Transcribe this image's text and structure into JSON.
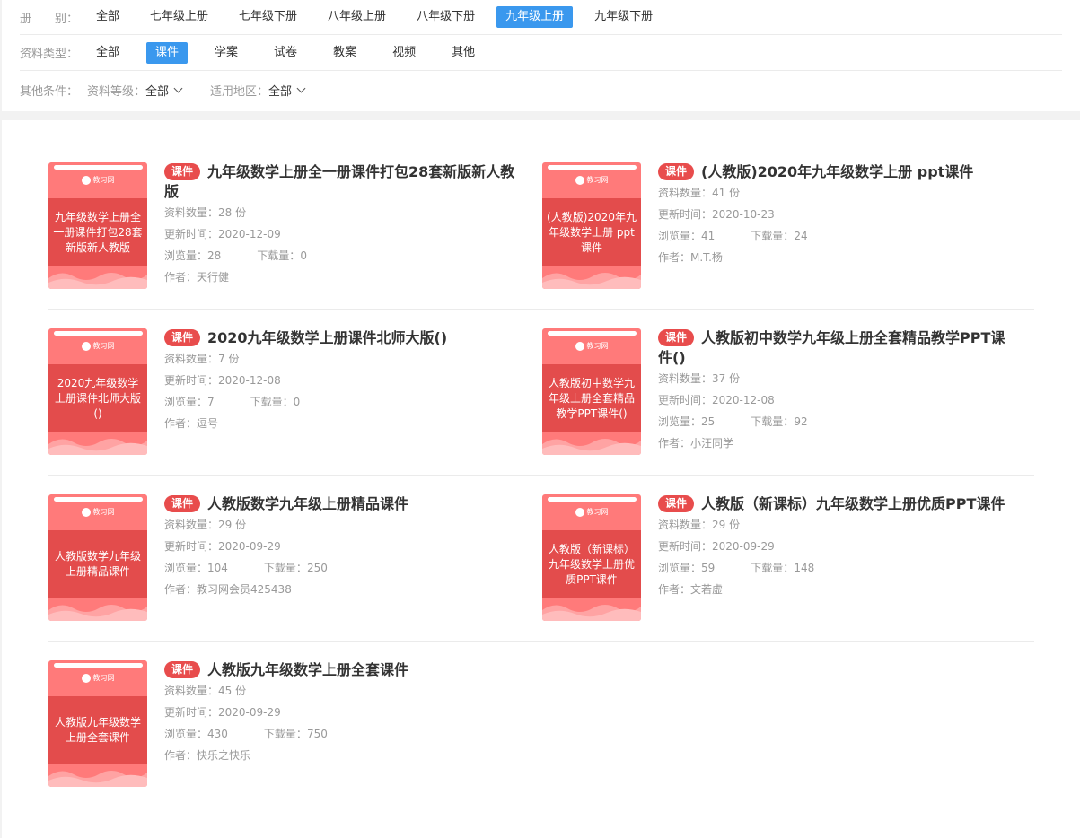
{
  "filters": {
    "grade": {
      "label": "册　　别：",
      "options": [
        "全部",
        "七年级上册",
        "七年级下册",
        "八年级上册",
        "八年级下册",
        "九年级上册",
        "九年级下册"
      ],
      "active": "九年级上册"
    },
    "type": {
      "label": "资料类型：",
      "options": [
        "全部",
        "课件",
        "学案",
        "试卷",
        "教案",
        "视频",
        "其他"
      ],
      "active": "课件"
    },
    "other": {
      "label": "其他条件：",
      "level_label": "资料等级：",
      "level_value": "全部",
      "region_label": "适用地区：",
      "region_value": "全部"
    }
  },
  "cover_logo": "教习网",
  "labels": {
    "tag": "课件",
    "count": "资料数量：",
    "count_unit": " 份",
    "updated": "更新时间：",
    "views": "浏览量：",
    "downloads": "下载量：",
    "author": "作者："
  },
  "items": [
    {
      "title": "九年级数学上册全一册课件打包28套新版新人教版",
      "cover_text": "九年级数学上册全一册课件打包28套新版新人教版",
      "count": "28",
      "updated": "2020-12-09",
      "views": "28",
      "downloads": "0",
      "author": "天行健"
    },
    {
      "title": "(人教版)2020年九年级数学上册 ppt课件",
      "cover_text": "(人教版)2020年九年级数学上册 ppt课件",
      "count": "41",
      "updated": "2020-10-23",
      "views": "41",
      "downloads": "24",
      "author": "M.T.杨"
    },
    {
      "title": "2020九年级数学上册课件北师大版()",
      "cover_text": "2020九年级数学上册课件北师大版()",
      "count": "7",
      "updated": "2020-12-08",
      "views": "7",
      "downloads": "0",
      "author": "逗号"
    },
    {
      "title": "人教版初中数学九年级上册全套精品教学PPT课件()",
      "cover_text": "人教版初中数学九年级上册全套精品教学PPT课件()",
      "count": "37",
      "updated": "2020-12-08",
      "views": "25",
      "downloads": "92",
      "author": "小汪同学"
    },
    {
      "title": "人教版数学九年级上册精品课件",
      "cover_text": "人教版数学九年级上册精品课件",
      "count": "29",
      "updated": "2020-09-29",
      "views": "104",
      "downloads": "250",
      "author": "教习网会员425438"
    },
    {
      "title": "人教版（新课标）九年级数学上册优质PPT课件",
      "cover_text": "人教版（新课标）九年级数学上册优质PPT课件",
      "count": "29",
      "updated": "2020-09-29",
      "views": "59",
      "downloads": "148",
      "author": "文若虚"
    },
    {
      "title": "人教版九年级数学上册全套课件",
      "cover_text": "人教版九年级数学上册全套课件",
      "count": "45",
      "updated": "2020-09-29",
      "views": "430",
      "downloads": "750",
      "author": "快乐之快乐"
    }
  ]
}
